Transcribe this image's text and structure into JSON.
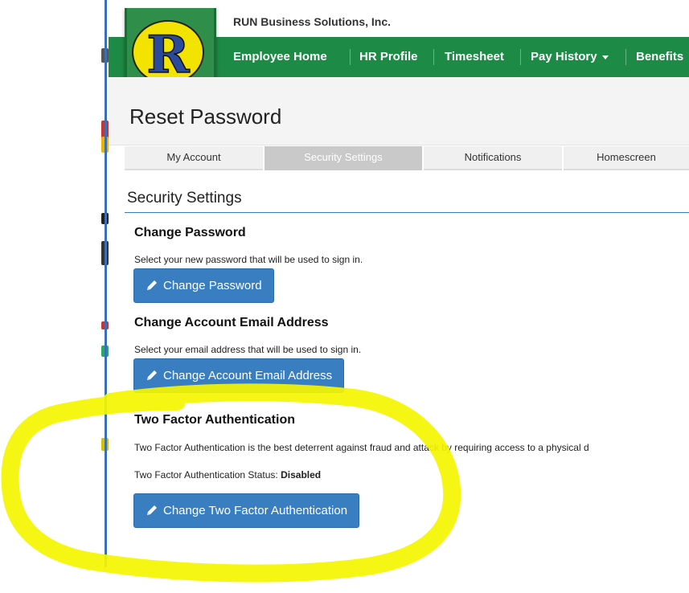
{
  "header": {
    "company_name": "RUN Business Solutions, Inc.",
    "logo_letter": "R"
  },
  "nav": {
    "items": [
      {
        "label": "Employee Home"
      },
      {
        "label": "HR Profile"
      },
      {
        "label": "Timesheet"
      },
      {
        "label": "Pay History"
      },
      {
        "label": "Benefits"
      }
    ]
  },
  "page": {
    "title": "Reset Password"
  },
  "tabs": [
    {
      "label": "My Account",
      "active": false
    },
    {
      "label": "Security Settings",
      "active": true
    },
    {
      "label": "Notifications",
      "active": false
    },
    {
      "label": "Homescreen",
      "active": false
    }
  ],
  "security": {
    "heading": "Security Settings",
    "change_password": {
      "heading": "Change Password",
      "description": "Select your new password that will be used to sign in.",
      "button_label": "Change Password"
    },
    "change_email": {
      "heading": "Change Account Email Address",
      "description": "Select your email address that will be used to sign in.",
      "button_label": "Change Account Email Address"
    },
    "two_factor": {
      "heading": "Two Factor Authentication",
      "description": "Two Factor Authentication is the best deterrent against fraud and attack by requiring access to a physical d",
      "status_label": "Two Factor Authentication Status:",
      "status_value": "Disabled",
      "button_label": "Change Two Factor Authentication"
    }
  },
  "colors": {
    "nav_green": "#1d8a45",
    "button_blue": "#3a7ec2",
    "highlight_yellow": "#f5f500"
  },
  "icons": {
    "button_icon": "pencil-icon"
  }
}
